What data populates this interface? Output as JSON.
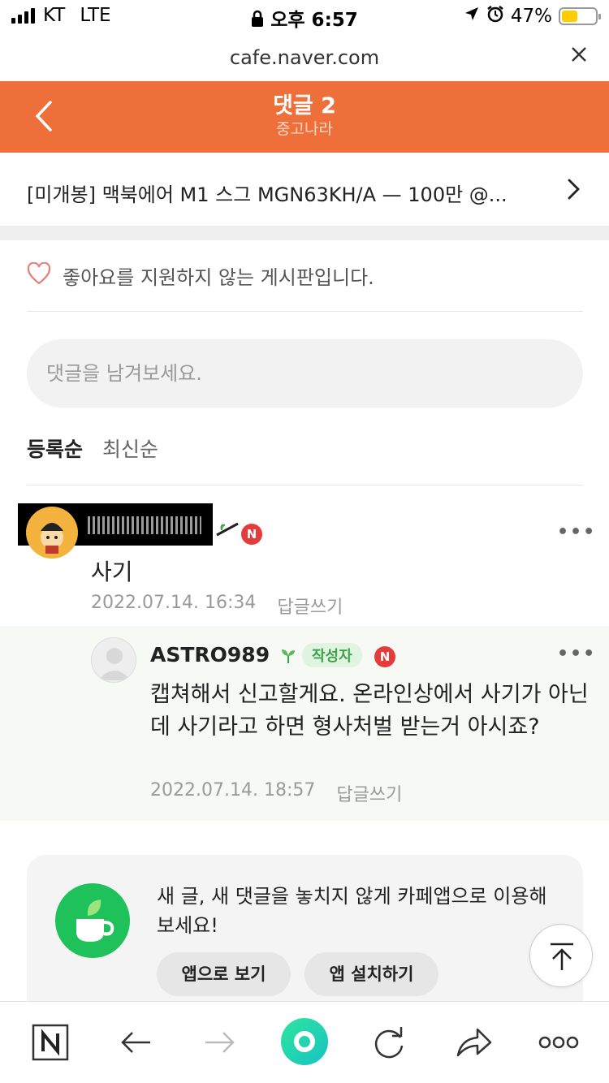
{
  "status_bar": {
    "carrier": "KT",
    "network": "LTE",
    "time": "오후 6:57",
    "battery": "47%",
    "battery_level": 0.47
  },
  "browser": {
    "url": "cafe.naver.com",
    "close_icon": "close-icon"
  },
  "header": {
    "title": "댓글 2",
    "subtitle": "중고나라",
    "back_icon": "back-arrow-icon",
    "color": "#ef6f3b"
  },
  "post": {
    "title": "[미개봉] 맥북에어 M1 스그 MGN63KH/A — 100만 @..."
  },
  "like_note": "좋아요를 지원하지 않는 게시판입니다.",
  "comment_input": {
    "placeholder": "댓글을 남겨보세요."
  },
  "sort": {
    "active": "등록순",
    "inactive": "최신순"
  },
  "comments": [
    {
      "author": "",
      "body": "사기",
      "date": "2022.07.14. 16:34",
      "reply_label": "답글쓰기",
      "more": "•••"
    }
  ],
  "reply": {
    "author": "ASTRO989",
    "author_badge": "작성자",
    "body": "캡쳐해서 신고할게요. 온라인상에서 사기가 아닌데 사기라고 하면 형사처벌 받는거 아시죠?",
    "date": "2022.07.14. 18:57",
    "reply_label": "답글쓰기",
    "more": "•••"
  },
  "new_badge": "N",
  "promo": {
    "message": "새 글, 새 댓글을 놓치지 않게 카페앱으로 이용해보세요!",
    "btn_open": "앱으로 보기",
    "btn_install": "앱 설치하기"
  },
  "bottom_bar": {
    "items": [
      "naver-home-icon",
      "back-arrow-icon",
      "forward-arrow-icon",
      "greendot-icon",
      "refresh-icon",
      "share-icon",
      "more-icon"
    ]
  }
}
